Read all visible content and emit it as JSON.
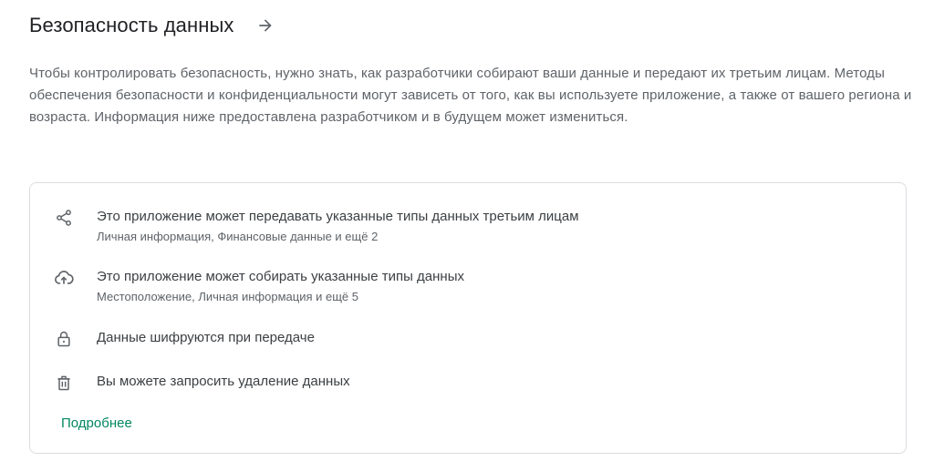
{
  "header": {
    "title": "Безопасность данных",
    "arrow_icon": "arrow-right-icon"
  },
  "description": "Чтобы контролировать безопасность, нужно знать, как разработчики собирают ваши данные и передают их третьим лицам. Методы обеспечения безопасности и конфиденциальности могут зависеть от того, как вы используете приложение, а также от вашего региона и возраста. Информация ниже предоставлена разработчиком и в будущем может измениться.",
  "items": [
    {
      "icon": "share-icon",
      "title": "Это приложение может передавать указанные типы данных третьим лицам",
      "subtitle": "Личная информация, Финансовые данные и ещё 2"
    },
    {
      "icon": "cloud-upload-icon",
      "title": "Это приложение может собирать указанные типы данных",
      "subtitle": "Местоположение, Личная информация и ещё 5"
    },
    {
      "icon": "lock-icon",
      "title": "Данные шифруются при передаче"
    },
    {
      "icon": "trash-icon",
      "title": "Вы можете запросить удаление данных"
    }
  ],
  "more_link": "Подробнее",
  "colors": {
    "text_primary": "#202124",
    "text_secondary": "#5f6368",
    "link": "#01875f",
    "border": "#dadce0"
  }
}
